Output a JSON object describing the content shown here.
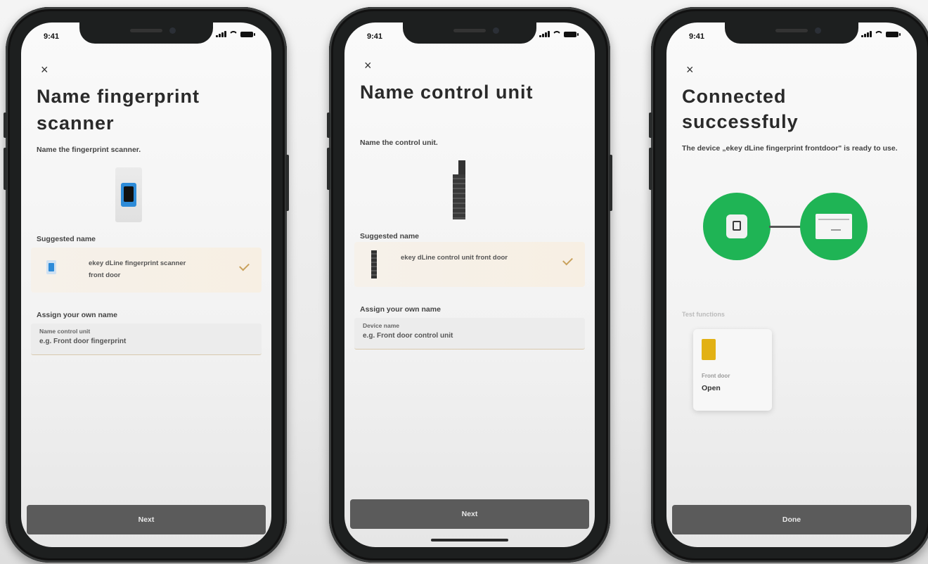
{
  "status_time": "9:41",
  "close_glyph": "×",
  "colors": {
    "accent_gold": "#c9a15c",
    "success_green": "#1fb455",
    "button_bg": "#5b5b5b"
  },
  "screen1": {
    "title_line1": "Name fingerprint",
    "title_line2": "scanner",
    "subtitle": "Name the fingerprint scanner.",
    "suggested_label": "Suggested name",
    "suggested_line1": "ekey dLine fingerprint scanner",
    "suggested_line2": "front door",
    "assign_label": "Assign your own name",
    "field_label": "Name control unit",
    "field_placeholder": "e.g. Front door fingerprint",
    "button": "Next"
  },
  "screen2": {
    "title": "Name control unit",
    "subtitle": "Name the control unit.",
    "suggested_label": "Suggested name",
    "suggested_line1": "ekey dLine control unit front door",
    "assign_label": "Assign your own name",
    "field_label": "Device name",
    "field_placeholder": "e.g. Front door control unit",
    "button": "Next"
  },
  "screen3": {
    "title_line1": "Connected",
    "title_line2": "successfuly",
    "description": "The device „ekey dLine fingerprint frontdoor\" is ready to use.",
    "functions_label": "Test functions",
    "function_name": "Front door",
    "function_state": "Open",
    "button": "Done"
  }
}
